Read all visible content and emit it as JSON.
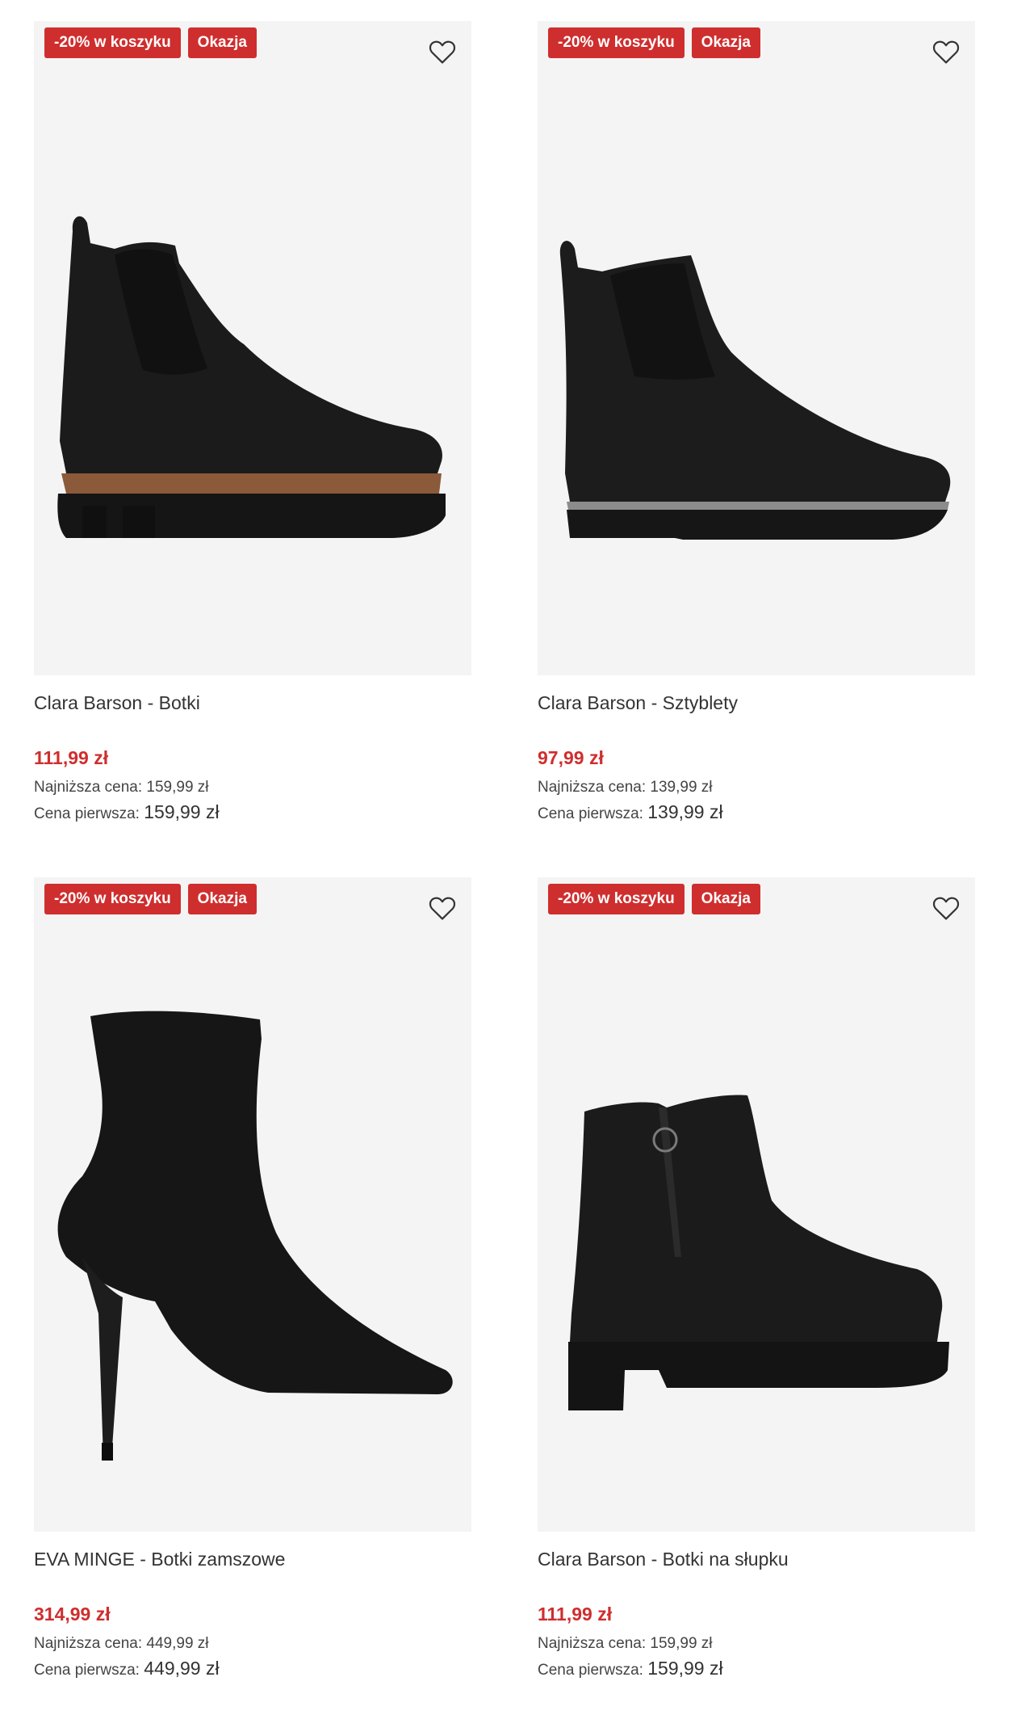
{
  "colors": {
    "badge_bg": "#cf2e2e",
    "price": "#cf2e2e",
    "image_bg": "#f4f4f4"
  },
  "products": [
    {
      "badges": [
        "-20% w koszyku",
        "Okazja"
      ],
      "favorite_icon": "heart-outline-icon",
      "name": "Clara Barson - Botki",
      "price": "111,99 zł",
      "lowest_label": "Najniższa cena:",
      "lowest_value": "159,99 zł",
      "first_label": "Cena pierwsza:",
      "first_value": "159,99 zł"
    },
    {
      "badges": [
        "-20% w koszyku",
        "Okazja"
      ],
      "favorite_icon": "heart-outline-icon",
      "name": "Clara Barson - Sztyblety",
      "price": "97,99 zł",
      "lowest_label": "Najniższa cena:",
      "lowest_value": "139,99 zł",
      "first_label": "Cena pierwsza:",
      "first_value": "139,99 zł"
    },
    {
      "badges": [
        "-20% w koszyku",
        "Okazja"
      ],
      "favorite_icon": "heart-outline-icon",
      "name": "EVA MINGE - Botki zamszowe",
      "price": "314,99 zł",
      "lowest_label": "Najniższa cena:",
      "lowest_value": "449,99 zł",
      "first_label": "Cena pierwsza:",
      "first_value": "449,99 zł"
    },
    {
      "badges": [
        "-20% w koszyku",
        "Okazja"
      ],
      "favorite_icon": "heart-outline-icon",
      "name": "Clara Barson - Botki na słupku",
      "price": "111,99 zł",
      "lowest_label": "Najniższa cena:",
      "lowest_value": "159,99 zł",
      "first_label": "Cena pierwsza:",
      "first_value": "159,99 zł"
    }
  ]
}
